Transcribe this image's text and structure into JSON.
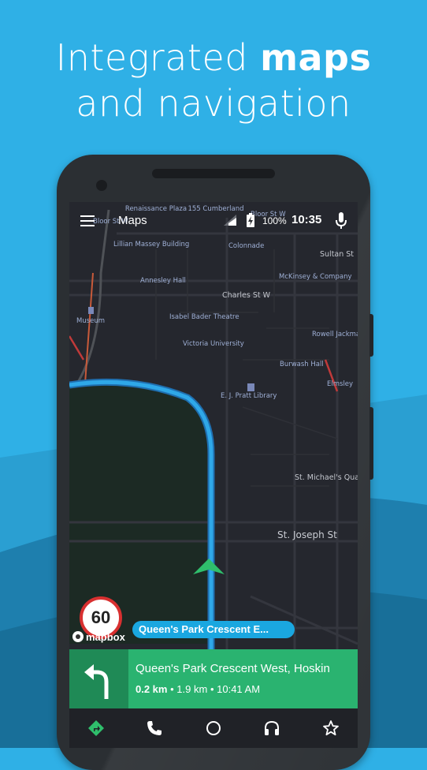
{
  "headline": {
    "line1_regular": "Integrated",
    "line1_bold": "maps",
    "line2": "and navigation"
  },
  "status_bar": {
    "app_title": "Maps",
    "battery_percent": "100%",
    "time": "10:35"
  },
  "map_labels": {
    "renaissance_plaza": "Renaissance Plaza",
    "cumberland": "155 Cumberland",
    "bloor_st_w": "Bloor St W",
    "bloor_st_w_2": "Bloor St W",
    "lillian_massey": "Lillian Massey Building",
    "colonnade": "Colonnade",
    "sultan_st": "Sultan St",
    "annesley_hall": "Annesley Hall",
    "mckinsey": "McKinsey & Company",
    "charles_st_w": "Charles St W",
    "museum": "Museum",
    "isabel_bader": "Isabel Bader Theatre",
    "rowell_jackman": "Rowell Jackman Hall",
    "victoria_university": "Victoria University",
    "burwash_hall": "Burwash Hall",
    "elmsley": "Elmsley",
    "pratt_library": "E. J. Pratt Library",
    "st_michaels": "St. Michael's Quad",
    "st_joseph_st": "St. Joseph St"
  },
  "speed_limit": "60",
  "attribution": "mapbox",
  "current_street": "Queen's Park Crescent E...",
  "navigation": {
    "next_street": "Queen's Park Crescent West, Hoskin",
    "distance_to_turn": "0.2 km",
    "remaining_distance": "1.9 km",
    "eta": "10:41 AM",
    "separator": "•"
  },
  "bottom_nav": [
    "navigation-icon",
    "phone-icon",
    "home-circle-icon",
    "headphones-icon",
    "star-icon"
  ],
  "colors": {
    "background": "#2fb0e6",
    "route": "#2fa8e8",
    "nav_card": "#2ab370",
    "speed_ring": "#d83030"
  }
}
